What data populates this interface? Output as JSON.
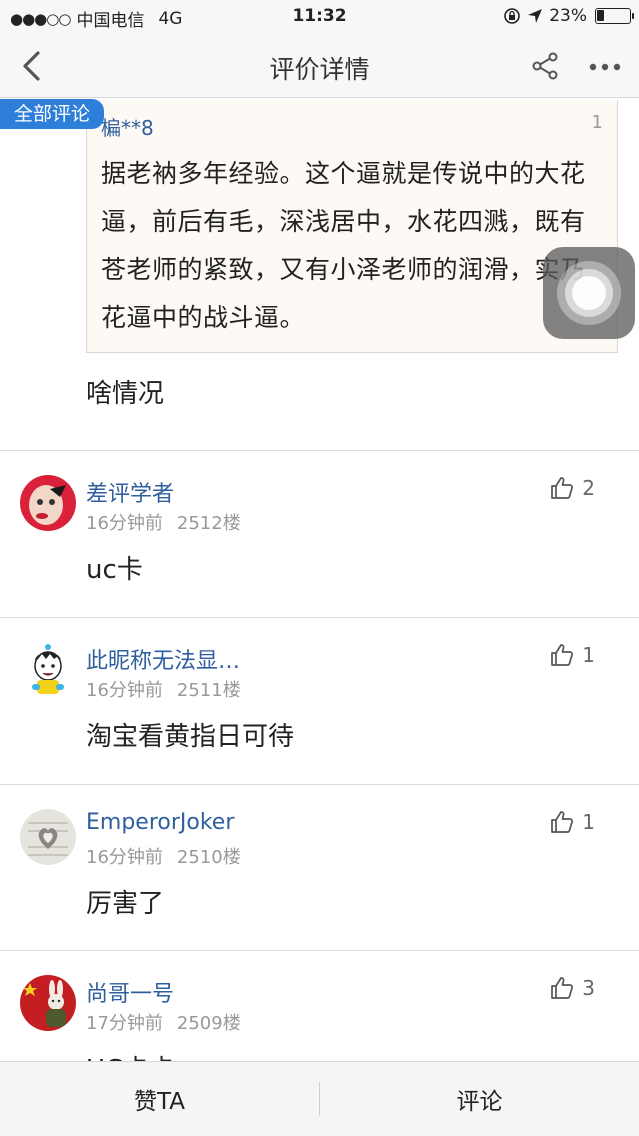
{
  "status_bar": {
    "carrier": "中国电信",
    "network": "4G",
    "time": "11:32",
    "battery": "23%",
    "battery_level": 0.23
  },
  "nav": {
    "title": "评价详情",
    "icons": [
      "back-chevron-icon",
      "share-icon",
      "more-icon"
    ]
  },
  "all_comments_tag": "全部评论",
  "quote": {
    "user": "楄**8",
    "number": "1",
    "text": "据老衲多年经验。这个逼就是传说中的大花逼，前后有毛，深浅居中，水花四溅，既有苍老师的紧致，又有小泽老师的润滑，实乃花逼中的战斗逼。"
  },
  "reply": "啥情况",
  "comments": [
    {
      "user": "差评学者",
      "time": "16分钟前",
      "floor": "2512楼",
      "likes": "2",
      "text": "uc卡"
    },
    {
      "user": "此昵称无法显…",
      "time": "16分钟前",
      "floor": "2511楼",
      "likes": "1",
      "text": "淘宝看黄指日可待"
    },
    {
      "user": "EmperorJoker",
      "time": "16分钟前",
      "floor": "2510楼",
      "likes": "1",
      "text": "厉害了"
    },
    {
      "user": "尚哥一号",
      "time": "17分钟前",
      "floor": "2509楼",
      "likes": "3",
      "text": "UC卡卡"
    }
  ],
  "bottom_bar": {
    "like_label": "赞TA",
    "comment_label": "评论"
  },
  "colors": {
    "accent": "#2e7fd9",
    "username": "#2f5f9e",
    "meta": "#999999"
  }
}
